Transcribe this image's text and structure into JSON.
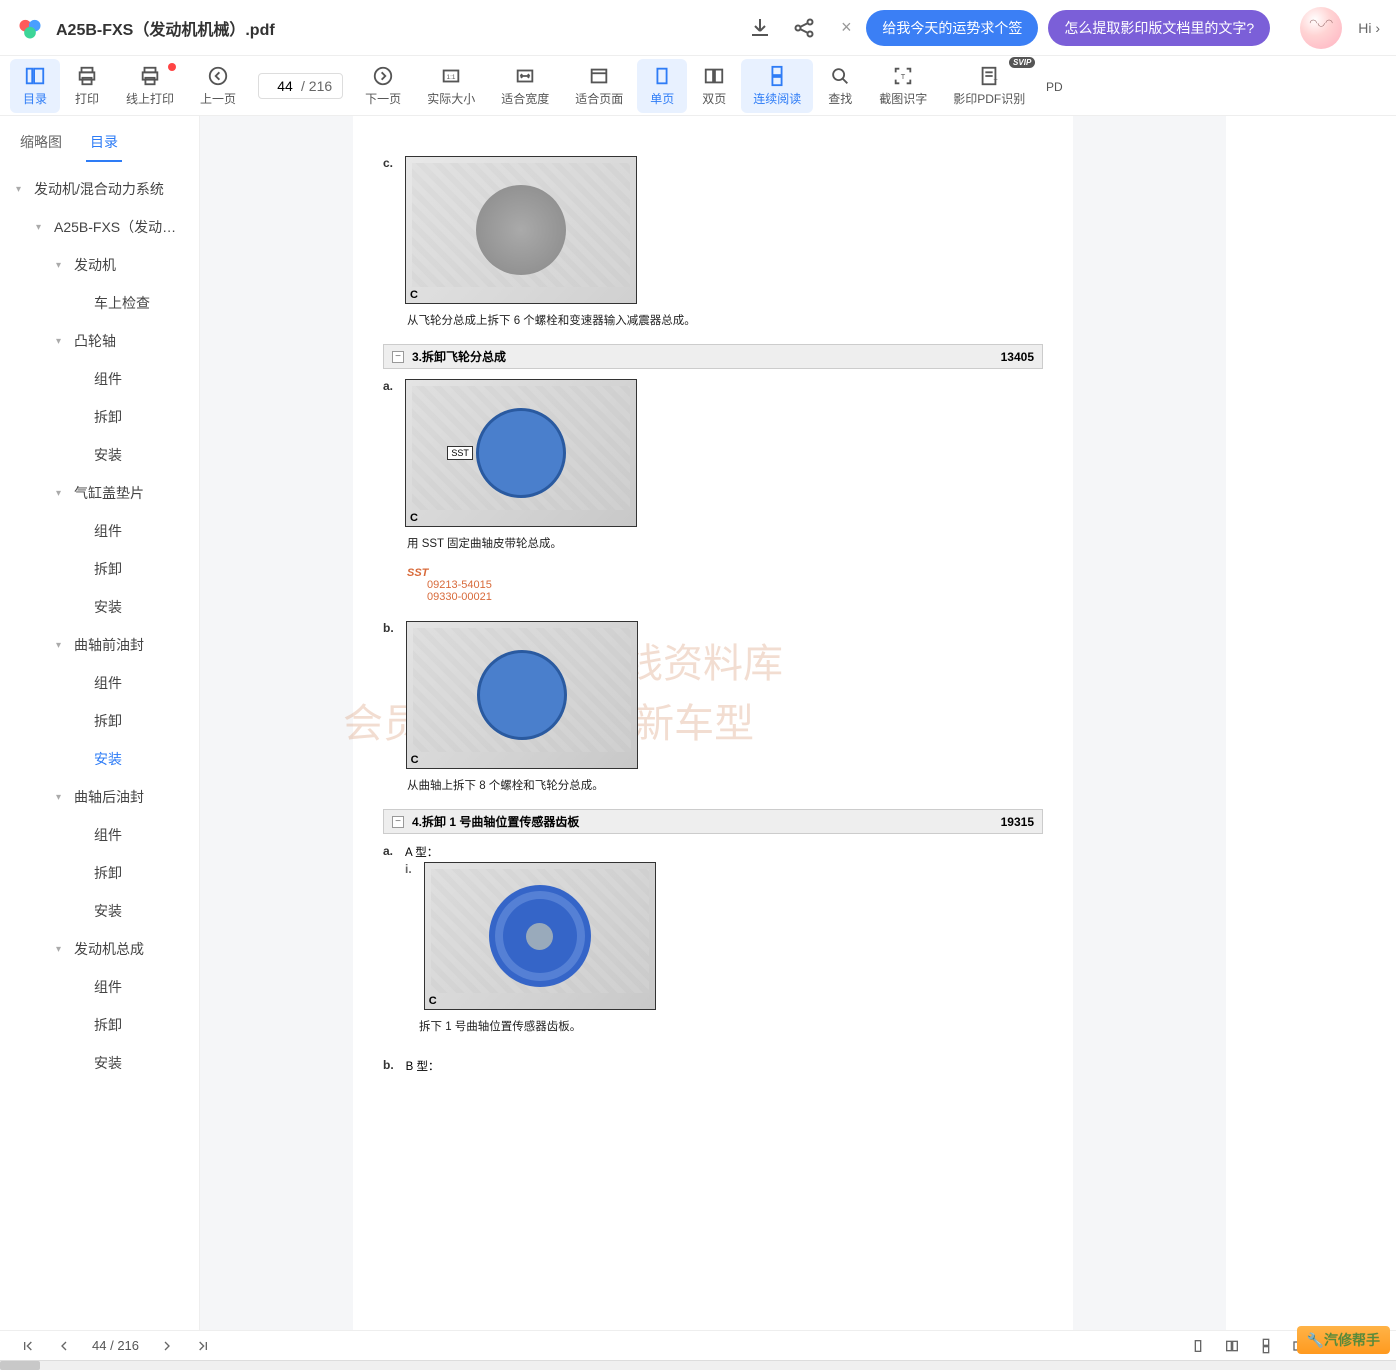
{
  "header": {
    "doc_title": "A25B-FXS（发动机机械）.pdf",
    "ai_prompts": [
      "给我今天的运势求个签",
      "怎么提取影印版文档里的文字?"
    ],
    "hi_text": "Hi"
  },
  "toolbar": {
    "items": [
      {
        "label": "目录",
        "active": true
      },
      {
        "label": "打印"
      },
      {
        "label": "线上打印",
        "dot": true
      },
      {
        "label": "上一页"
      },
      {
        "label": "下一页"
      },
      {
        "label": "实际大小"
      },
      {
        "label": "适合宽度"
      },
      {
        "label": "适合页面"
      },
      {
        "label": "单页",
        "active": true
      },
      {
        "label": "双页"
      },
      {
        "label": "连续阅读",
        "active": true
      },
      {
        "label": "查找"
      },
      {
        "label": "截图识字"
      },
      {
        "label": "影印PDF识别",
        "svip": true
      },
      {
        "label": "PD"
      }
    ],
    "page_current": "44",
    "page_total": "/ 216"
  },
  "sidebar": {
    "tabs": [
      {
        "label": "缩略图"
      },
      {
        "label": "目录",
        "active": true
      }
    ],
    "outline": [
      {
        "label": "发动机/混合动力系统",
        "level": 0,
        "caret": true
      },
      {
        "label": "A25B-FXS（发动…",
        "level": 1,
        "caret": true
      },
      {
        "label": "发动机",
        "level": 2,
        "caret": true
      },
      {
        "label": "车上检查",
        "level": 3
      },
      {
        "label": "凸轮轴",
        "level": 2,
        "caret": true
      },
      {
        "label": "组件",
        "level": 3
      },
      {
        "label": "拆卸",
        "level": 3
      },
      {
        "label": "安装",
        "level": 3
      },
      {
        "label": "气缸盖垫片",
        "level": 2,
        "caret": true
      },
      {
        "label": "组件",
        "level": 3
      },
      {
        "label": "拆卸",
        "level": 3
      },
      {
        "label": "安装",
        "level": 3
      },
      {
        "label": "曲轴前油封",
        "level": 2,
        "caret": true
      },
      {
        "label": "组件",
        "level": 3
      },
      {
        "label": "拆卸",
        "level": 3
      },
      {
        "label": "安装",
        "level": 3,
        "active": true
      },
      {
        "label": "曲轴后油封",
        "level": 2,
        "caret": true
      },
      {
        "label": "组件",
        "level": 3
      },
      {
        "label": "拆卸",
        "level": 3
      },
      {
        "label": "安装",
        "level": 3
      },
      {
        "label": "发动机总成",
        "level": 2,
        "caret": true
      },
      {
        "label": "组件",
        "level": 3
      },
      {
        "label": "拆卸",
        "level": 3
      },
      {
        "label": "安装",
        "level": 3
      }
    ]
  },
  "doc": {
    "step_c": {
      "marker": "c.",
      "img_label": "C",
      "caption": "从飞轮分总成上拆下 6 个螺栓和变速器输入减震器总成。"
    },
    "section3": {
      "title": "3.拆卸飞轮分总成",
      "code": "13405"
    },
    "step_a": {
      "marker": "a.",
      "img_label": "C",
      "sst_tag": "SST",
      "caption": "用 SST 固定曲轴皮带轮总成。"
    },
    "sst": {
      "label": "SST",
      "num1": "09213-54015",
      "num2": "09330-00021"
    },
    "step_b": {
      "marker": "b.",
      "img_label": "C",
      "caption": "从曲轴上拆下 8 个螺栓和飞轮分总成。"
    },
    "section4": {
      "title": "4.拆卸 1 号曲轴位置传感器齿板",
      "code": "19315"
    },
    "step_a2": {
      "marker": "a.",
      "type_label": "A 型：",
      "sub_i": "i.",
      "img_label": "C",
      "caption": "拆下 1 号曲轴位置传感器齿板。"
    },
    "step_b2": {
      "marker": "b.",
      "type_label": "B 型："
    },
    "watermark1": "汽修帮手在线资料库",
    "watermark2": "会员             年，每周更新车型"
  },
  "bottom": {
    "page_current": "44",
    "page_total": "/ 216",
    "brand": "汽修帮手"
  }
}
